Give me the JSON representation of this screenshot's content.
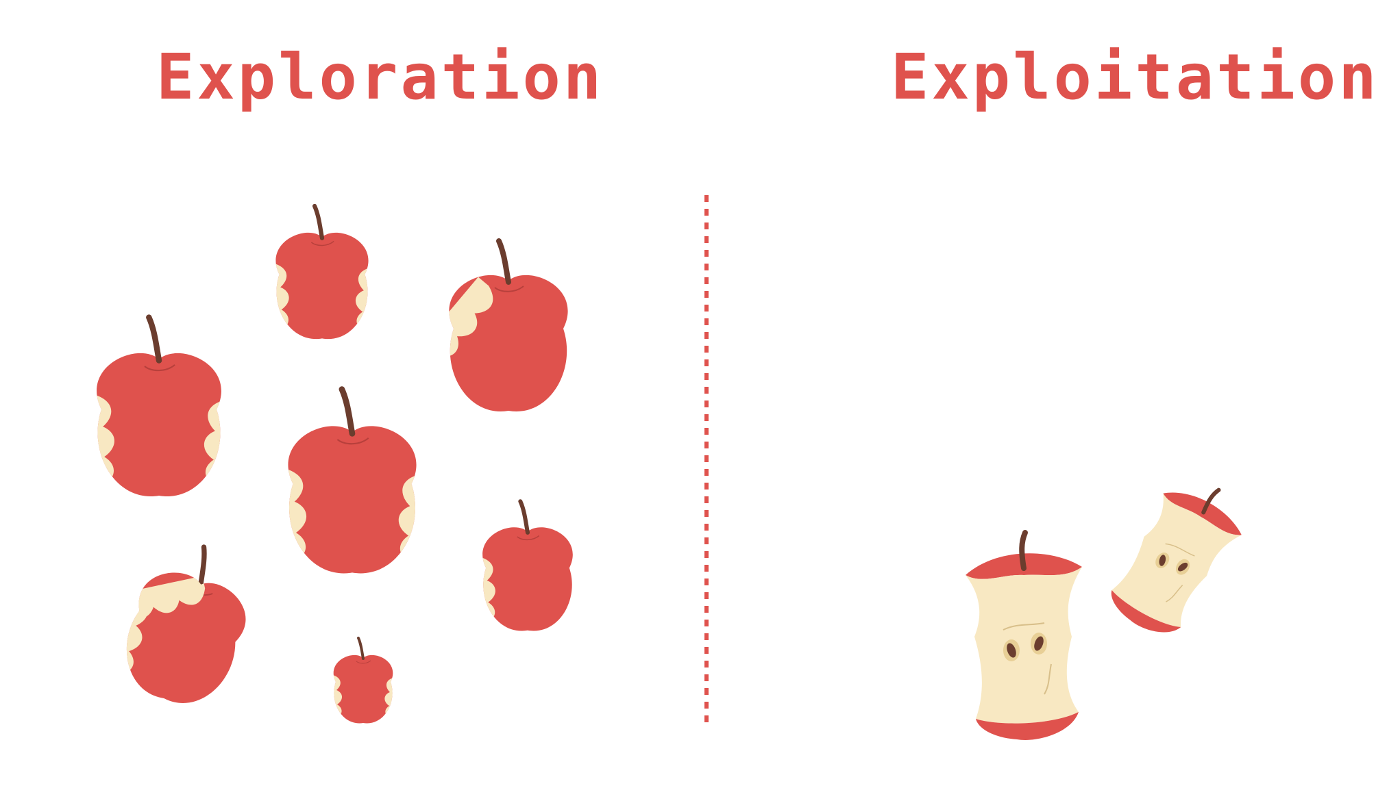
{
  "headings": {
    "left": "Exploration",
    "right": "Exploitation"
  },
  "colors": {
    "apple_red": "#df524d",
    "flesh": "#f8e8c2",
    "stem": "#6b3d2e",
    "divider": "#df524d",
    "heading": "#df524d"
  },
  "icons": {
    "left_panel": [
      "bitten-apple-icon"
    ],
    "right_panel": [
      "apple-core-icon"
    ]
  }
}
